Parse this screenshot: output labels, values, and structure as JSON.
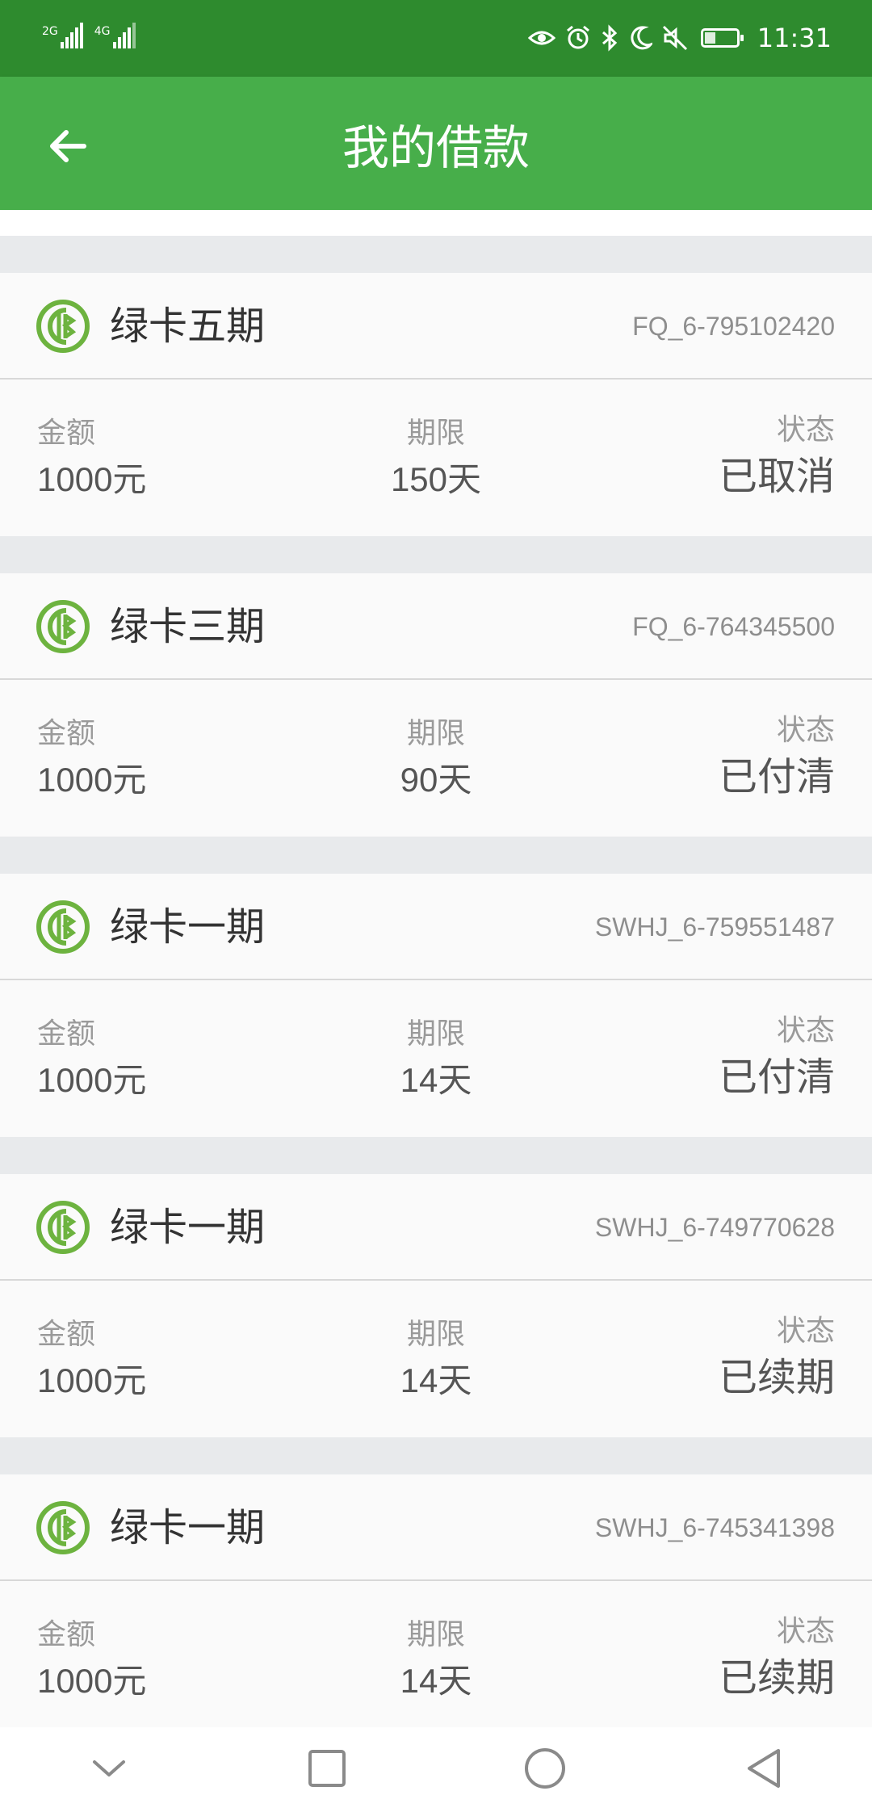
{
  "status_bar": {
    "network1": "2G",
    "network2": "4G",
    "time": "11:31",
    "battery_level": 0.35,
    "icons": [
      "eye-icon",
      "alarm-icon",
      "bluetooth-icon",
      "moon-icon",
      "mute-icon",
      "battery-icon"
    ]
  },
  "app_bar": {
    "title": "我的借款",
    "back_icon": "arrow-left-icon",
    "color": "#47ae4a"
  },
  "labels": {
    "amount": "金额",
    "term": "期限",
    "status": "状态"
  },
  "loans": [
    {
      "name": "绿卡五期",
      "id": "FQ_6-795102420",
      "amount": "1000元",
      "term": "150天",
      "status": "已取消"
    },
    {
      "name": "绿卡三期",
      "id": "FQ_6-764345500",
      "amount": "1000元",
      "term": "90天",
      "status": "已付清"
    },
    {
      "name": "绿卡一期",
      "id": "SWHJ_6-759551487",
      "amount": "1000元",
      "term": "14天",
      "status": "已付清"
    },
    {
      "name": "绿卡一期",
      "id": "SWHJ_6-749770628",
      "amount": "1000元",
      "term": "14天",
      "status": "已续期"
    },
    {
      "name": "绿卡一期",
      "id": "SWHJ_6-745341398",
      "amount": "1000元",
      "term": "14天",
      "status": "已续期"
    }
  ],
  "nav_bar": {
    "buttons": [
      "chevron-down-icon",
      "square-icon",
      "circle-icon",
      "triangle-back-icon"
    ]
  }
}
